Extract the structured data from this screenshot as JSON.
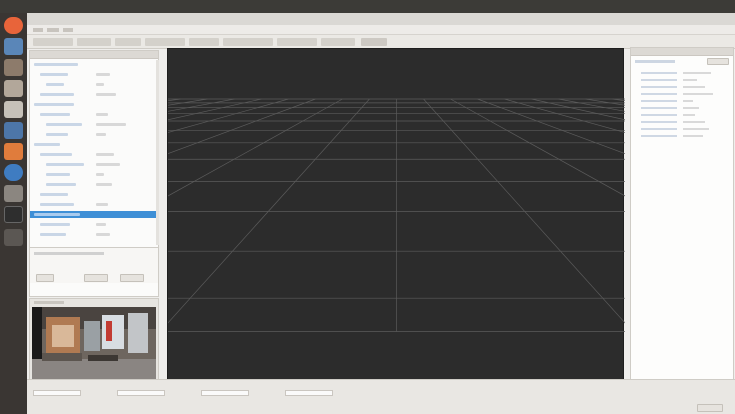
{
  "window": {
    "title": ""
  },
  "menu": {
    "items": [
      "",
      "",
      "",
      ""
    ]
  },
  "toolbar": {
    "tools": [
      "",
      "",
      "",
      "",
      "",
      "",
      "",
      "",
      ""
    ]
  },
  "displays_panel": {
    "title": "",
    "rows": [
      {
        "label": "",
        "value": ""
      },
      {
        "label": "",
        "value": ""
      },
      {
        "label": "",
        "value": ""
      },
      {
        "label": "",
        "value": ""
      },
      {
        "label": "",
        "value": ""
      },
      {
        "label": "",
        "value": ""
      },
      {
        "label": "",
        "value": ""
      },
      {
        "label": "",
        "value": ""
      },
      {
        "label": "",
        "value": ""
      },
      {
        "label": "",
        "value": ""
      },
      {
        "label": "",
        "value": ""
      },
      {
        "label": "",
        "value": ""
      },
      {
        "label": "",
        "value": ""
      },
      {
        "label": "",
        "value": ""
      },
      {
        "label": "",
        "value": ""
      },
      {
        "label": "",
        "value": ""
      },
      {
        "label": "",
        "value": ""
      },
      {
        "label": "",
        "value": ""
      }
    ],
    "selected_index": 15,
    "description": "",
    "buttons": [
      "",
      "",
      ""
    ]
  },
  "camera_panel": {
    "title": ""
  },
  "views_panel": {
    "title": "",
    "type_label": "",
    "props": [
      {
        "key": "",
        "value": ""
      },
      {
        "key": "",
        "value": ""
      },
      {
        "key": "",
        "value": ""
      },
      {
        "key": "",
        "value": ""
      },
      {
        "key": "",
        "value": ""
      },
      {
        "key": "",
        "value": ""
      },
      {
        "key": "",
        "value": ""
      },
      {
        "key": "",
        "value": ""
      },
      {
        "key": "",
        "value": ""
      },
      {
        "key": "",
        "value": ""
      }
    ],
    "buttons": [
      "",
      "",
      ""
    ]
  },
  "time_panel": {
    "fields": [
      {
        "label": "",
        "value": ""
      },
      {
        "label": "",
        "value": ""
      },
      {
        "label": "",
        "value": ""
      },
      {
        "label": "",
        "value": ""
      }
    ],
    "reset_label": ""
  },
  "colors": {
    "viewport_bg": "#2c2c2c",
    "grid": "#5b5b5b",
    "selection": "#3e8fd6"
  }
}
